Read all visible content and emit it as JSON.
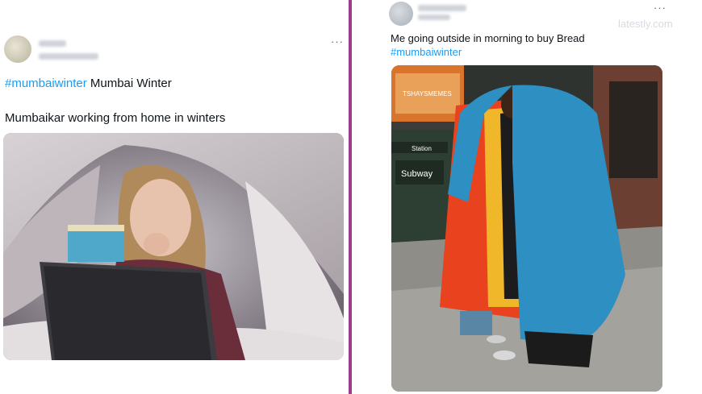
{
  "left_tweet": {
    "more_icon": "···",
    "hashtag": "#mumbaiwinter",
    "headline_rest": " Mumbai Winter",
    "body": "Mumbaikar working from home in winters",
    "media_icon": "woman-under-blanket-laptop-photo"
  },
  "right_tweet": {
    "more_icon": "···",
    "watermark": "latestly.com",
    "text": "Me going outside in morning to buy Bread",
    "hashtag": "#mumbaiwinter",
    "media_icon": "man-wearing-layered-jackets-photo",
    "sign_text": "Station",
    "sign_text2": "Subway"
  },
  "colors": {
    "hashtag": "#1d9bf0",
    "divider": "#9b3c8f"
  }
}
